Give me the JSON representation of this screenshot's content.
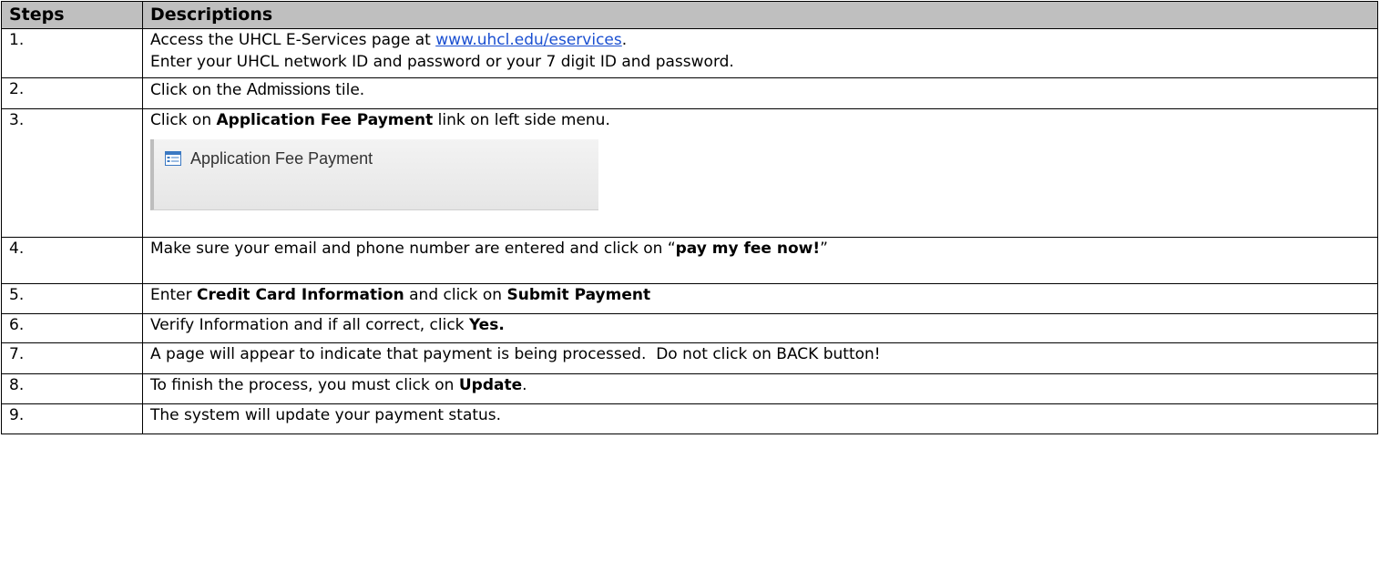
{
  "table": {
    "headers": {
      "steps": "Steps",
      "descriptions": "Descriptions"
    },
    "rows": [
      {
        "step": "1.",
        "line1_pre": "Access the UHCL E-Services page at ",
        "link": "www.uhcl.edu/eservices",
        "line1_post": ".",
        "line2": "Enter your UHCL network ID and password or your 7 digit ID and password."
      },
      {
        "step": "2.",
        "pre": "Click on the ",
        "bold": "Admissions",
        "post": " tile."
      },
      {
        "step": "3.",
        "pre": "Click on ",
        "bold": "Application Fee Payment",
        "post": " link on left side menu.",
        "image_label": "Application Fee Payment"
      },
      {
        "step": "4.",
        "pre": "Make sure your email and phone number are entered and click on “",
        "bold": "pay my fee now!",
        "post": "”"
      },
      {
        "step": "5.",
        "pre": "Enter ",
        "bold1": "Credit Card Information",
        "mid": " and click on ",
        "bold2": "Submit Payment"
      },
      {
        "step": "6.",
        "pre": "Verify Information and if all correct, click ",
        "bold": "Yes."
      },
      {
        "step": "7.",
        "text": "A page will appear to indicate that payment is being processed.  Do not click on BACK button!"
      },
      {
        "step": "8.",
        "pre": "To finish the process, you must click on ",
        "bold": "Update",
        "post": "."
      },
      {
        "step": "9.",
        "text": "The system will update your payment status."
      }
    ]
  },
  "icons": {
    "fee_icon": "page-list-icon",
    "fee_icon_color": "#3a78c2"
  },
  "colors": {
    "header_bg": "#bfbfbf",
    "link": "#1a4fd1",
    "border": "#000000"
  }
}
